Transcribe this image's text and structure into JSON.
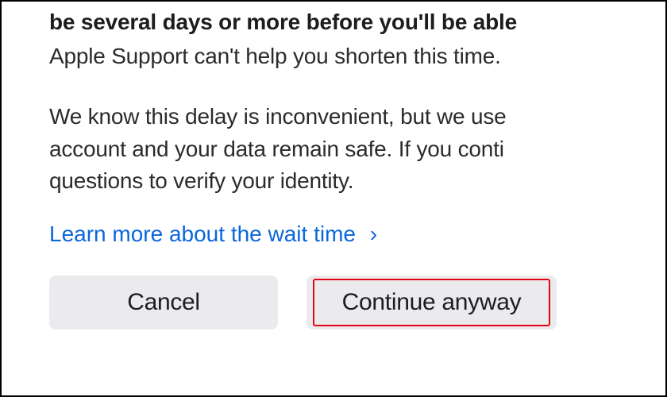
{
  "dialog": {
    "bold_line": "be several days or more before you'll be able",
    "para1_line1": "Apple Support can't help you shorten this time.",
    "para2_line1": "We know this delay is inconvenient, but we use",
    "para2_line2": "account and your data remain safe. If you conti",
    "para2_line3": "questions to verify your identity.",
    "link_text": "Learn more about the wait time",
    "chevron": "›",
    "cancel_label": "Cancel",
    "continue_label": "Continue anyway"
  }
}
